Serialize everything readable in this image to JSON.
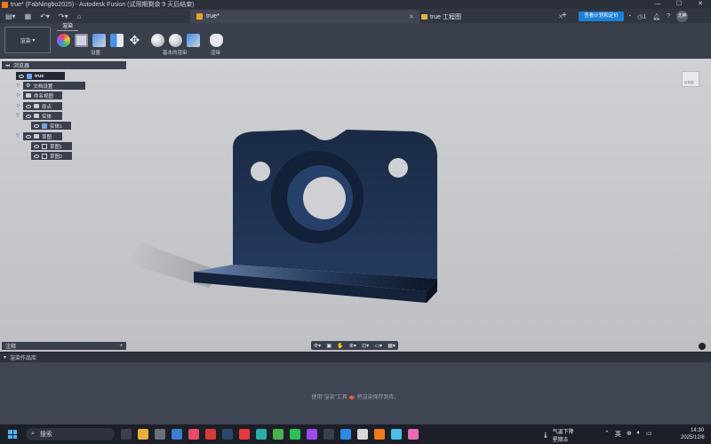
{
  "window": {
    "title": "true* (FabNingbo2025) - Autodesk Fusion (试用期剩余 9 天后结束)",
    "controls": [
      "—",
      "☐",
      "✕"
    ]
  },
  "tabs": [
    {
      "label": "true*"
    },
    {
      "label": "true 工程图"
    }
  ],
  "header": {
    "upgrade_label": "查看计划和定价",
    "notifications": "1",
    "avatar": "北神"
  },
  "toolbar": {
    "workspace": "渲染",
    "ribbon_tab": "渲染",
    "groups": [
      "设置",
      "基本的渲染",
      "渲染"
    ]
  },
  "browser": {
    "title": "浏览器",
    "items": [
      {
        "label": "true"
      },
      {
        "label": "文档设置"
      },
      {
        "label": "命名视图"
      },
      {
        "label": "原点"
      },
      {
        "label": "实体"
      },
      {
        "label": "实体1"
      },
      {
        "label": "草图"
      },
      {
        "label": "草图1"
      },
      {
        "label": "草图2"
      }
    ]
  },
  "viewcube": {
    "label": "前视图"
  },
  "notes": {
    "label": "注释"
  },
  "gallery": {
    "title": "渲染作品库",
    "message": "使用\"渲染\"工具 🫖 将渲染保存到库。"
  },
  "taskbar": {
    "search": "搜索",
    "weather_title": "气温下降",
    "weather_sub": "星期五",
    "lang": "英",
    "time": "14:30",
    "date": "2025/12/8"
  },
  "colors": {
    "part": "#1b2c48",
    "accent": "#1b7fd6"
  }
}
